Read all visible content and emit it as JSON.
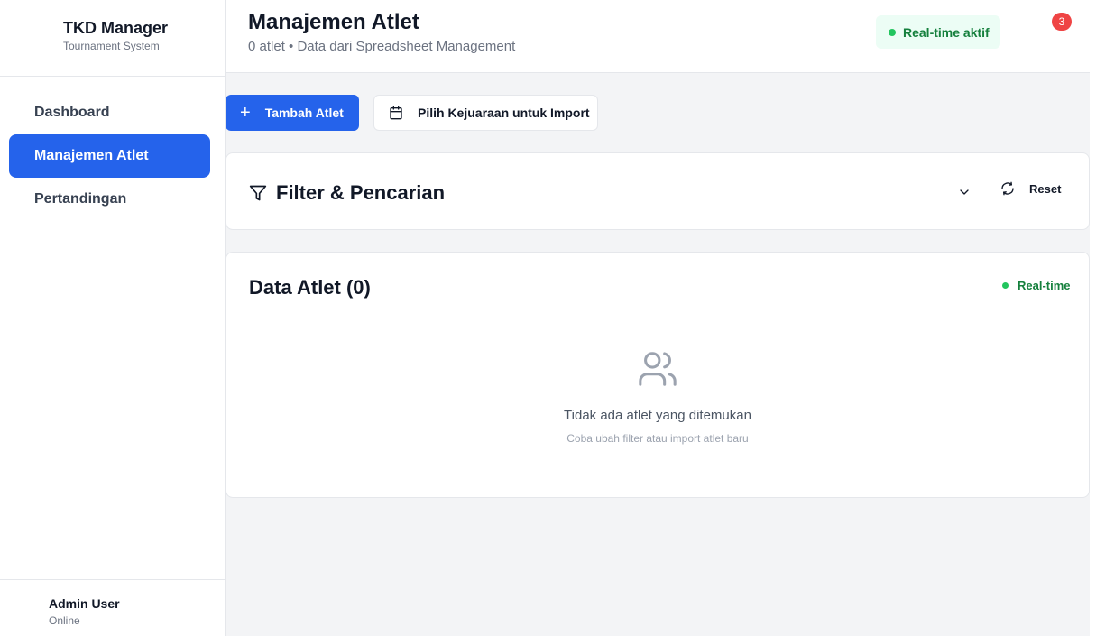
{
  "sidebar": {
    "brand_title": "TKD Manager",
    "brand_subtitle": "Tournament System",
    "items": [
      {
        "label": "Dashboard",
        "active": false
      },
      {
        "label": "Manajemen Atlet",
        "active": true
      },
      {
        "label": "Pertandingan",
        "active": false
      }
    ],
    "user": {
      "name": "Admin User",
      "status": "Online"
    }
  },
  "header": {
    "title": "Manajemen Atlet",
    "subtitle": "0 atlet • Data dari Spreadsheet Management",
    "realtime_label": "Real-time aktif",
    "notification_count": "3"
  },
  "actions": {
    "add_label": "Tambah Atlet",
    "import_label": "Pilih Kejuaraan untuk Import"
  },
  "filter": {
    "title": "Filter & Pencarian",
    "reset_label": "Reset"
  },
  "data": {
    "title": "Data Atlet (0)",
    "realtime_label": "Real-time",
    "empty_title": "Tidak ada atlet yang ditemukan",
    "empty_subtitle": "Coba ubah filter atau import atlet baru"
  },
  "colors": {
    "primary": "#2563eb",
    "success": "#22c55e",
    "danger": "#ef4444"
  }
}
